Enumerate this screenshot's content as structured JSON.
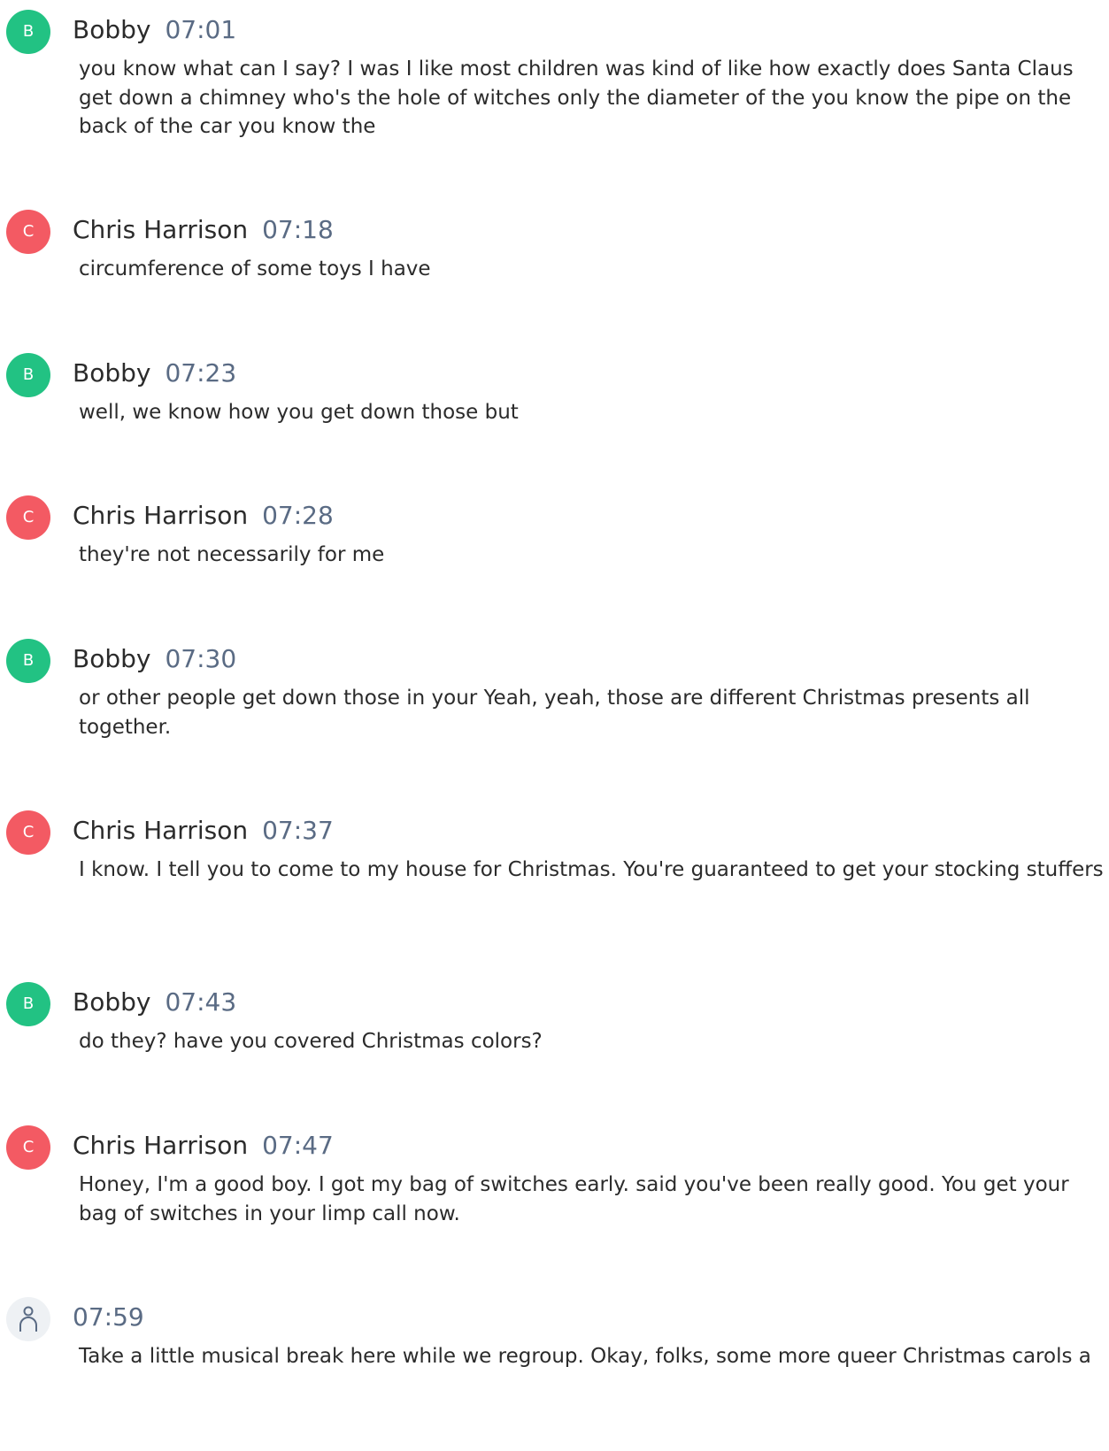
{
  "entries": [
    {
      "initial": "B",
      "speaker": "Bobby",
      "time": "07:01",
      "text": "you know what can I say? I was I like most children was kind of like how exactly does Santa Claus get down a chimney who's the hole of witches only the diameter of the you know the pipe on the back of the car you know the"
    },
    {
      "initial": "C",
      "speaker": "Chris Harrison",
      "time": "07:18",
      "text": "circumference of some toys I have"
    },
    {
      "initial": "B",
      "speaker": "Bobby",
      "time": "07:23",
      "text": "well, we know how you get down those but"
    },
    {
      "initial": "C",
      "speaker": "Chris Harrison",
      "time": "07:28",
      "text": "they're not necessarily for me"
    },
    {
      "initial": "B",
      "speaker": "Bobby",
      "time": "07:30",
      "text": "or other people get down those in your Yeah, yeah, those are different Christmas presents all together."
    },
    {
      "initial": "C",
      "speaker": "Chris Harrison",
      "time": "07:37",
      "text": "I know. I tell you to come to my house for Christmas. You're guaranteed to get your stocking stuffers"
    },
    {
      "initial": "B",
      "speaker": "Bobby",
      "time": "07:43",
      "text": "do they? have you covered Christmas colors?"
    },
    {
      "initial": "C",
      "speaker": "Chris Harrison",
      "time": "07:47",
      "text": "Honey, I'm a good boy. I got my bag of switches early. said you've been really good. You get your bag of switches in your limp call now."
    },
    {
      "icon": "person-icon",
      "time": "07:59",
      "text": "Take a little musical break here while we regroup. Okay, folks, some more queer Christmas carols a"
    }
  ],
  "colors": {
    "avatar_b": "#22c283",
    "avatar_c": "#f35a63",
    "avatar_unknown": "#eef1f4",
    "timestamp": "#5a6b84",
    "text": "#2b2b2b"
  }
}
